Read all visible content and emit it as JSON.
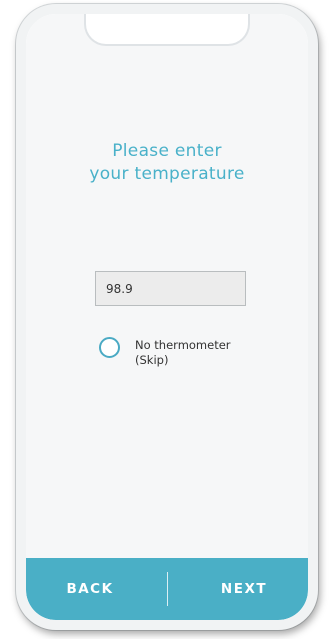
{
  "prompt": {
    "line1": "Please enter",
    "line2": "your temperature"
  },
  "temperature_field": {
    "value": "98.9"
  },
  "skip_option": {
    "label_line1": "No thermometer",
    "label_line2": "(Skip)",
    "selected": false
  },
  "footer": {
    "back_label": "BACK",
    "next_label": "NEXT"
  },
  "colors": {
    "accent": "#4aafc6",
    "title_text": "#49b1c9",
    "screen_bg": "#f6f7f8"
  }
}
